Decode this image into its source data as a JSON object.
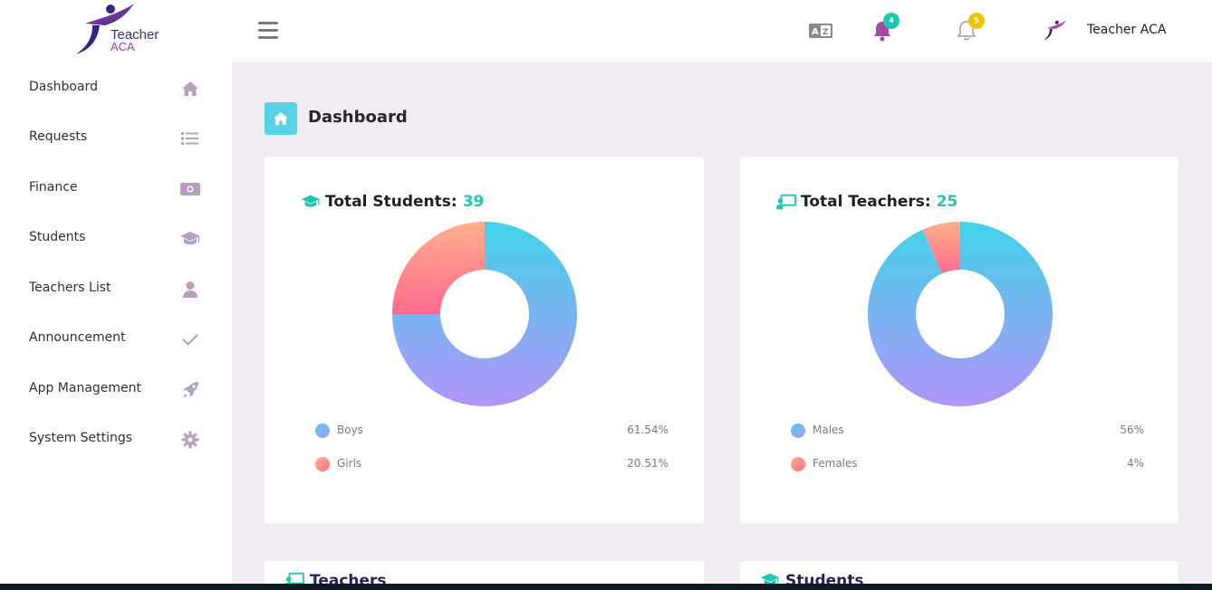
{
  "brand": {
    "line1": "Teacher",
    "line2": "ACA"
  },
  "sidebar": {
    "items": [
      {
        "label": "Dashboard",
        "icon": "home-icon"
      },
      {
        "label": "Requests",
        "icon": "list-icon"
      },
      {
        "label": "Finance",
        "icon": "money-icon"
      },
      {
        "label": "Students",
        "icon": "graduation-cap-icon"
      },
      {
        "label": "Teachers List",
        "icon": "user-icon"
      },
      {
        "label": "Announcement",
        "icon": "check-icon"
      },
      {
        "label": "App Management",
        "icon": "rocket-icon"
      },
      {
        "label": "System Settings",
        "icon": "gear-icon"
      }
    ]
  },
  "topbar": {
    "notification_count": "4",
    "alert_count": "5",
    "user_name": "Teacher ACA"
  },
  "page": {
    "title": "Dashboard"
  },
  "cards": {
    "students": {
      "title": "Total Students:",
      "value": "39"
    },
    "teachers": {
      "title": "Total Teachers:",
      "value": "25"
    }
  },
  "chart_data": [
    {
      "type": "pie",
      "title": "Total Students: 39",
      "categories": [
        "Boys",
        "Girls"
      ],
      "values": [
        61.54,
        20.51
      ],
      "value_labels": [
        "61.54%",
        "20.51%"
      ],
      "shown_slices_pct": [
        75,
        25
      ],
      "legend": "bottom"
    },
    {
      "type": "pie",
      "title": "Total Teachers: 25",
      "categories": [
        "Males",
        "Females"
      ],
      "values": [
        56,
        4
      ],
      "value_labels": [
        "56%",
        "4%"
      ],
      "shown_slices_pct": [
        93.3,
        6.7
      ],
      "legend": "bottom"
    }
  ],
  "lower": {
    "teachers_title": "Teachers",
    "students_title": "Students"
  },
  "colors": {
    "accent": "#1fc6b0",
    "tile": "#58d3e3",
    "sidebar_icon": "#b79fc0",
    "badge_yellow": "#f4c400",
    "gradient_blue_start": "#40d3e9",
    "gradient_blue_end": "#b294f8",
    "gradient_pink_start": "#ffb08a",
    "gradient_pink_end": "#ff6b8f"
  }
}
